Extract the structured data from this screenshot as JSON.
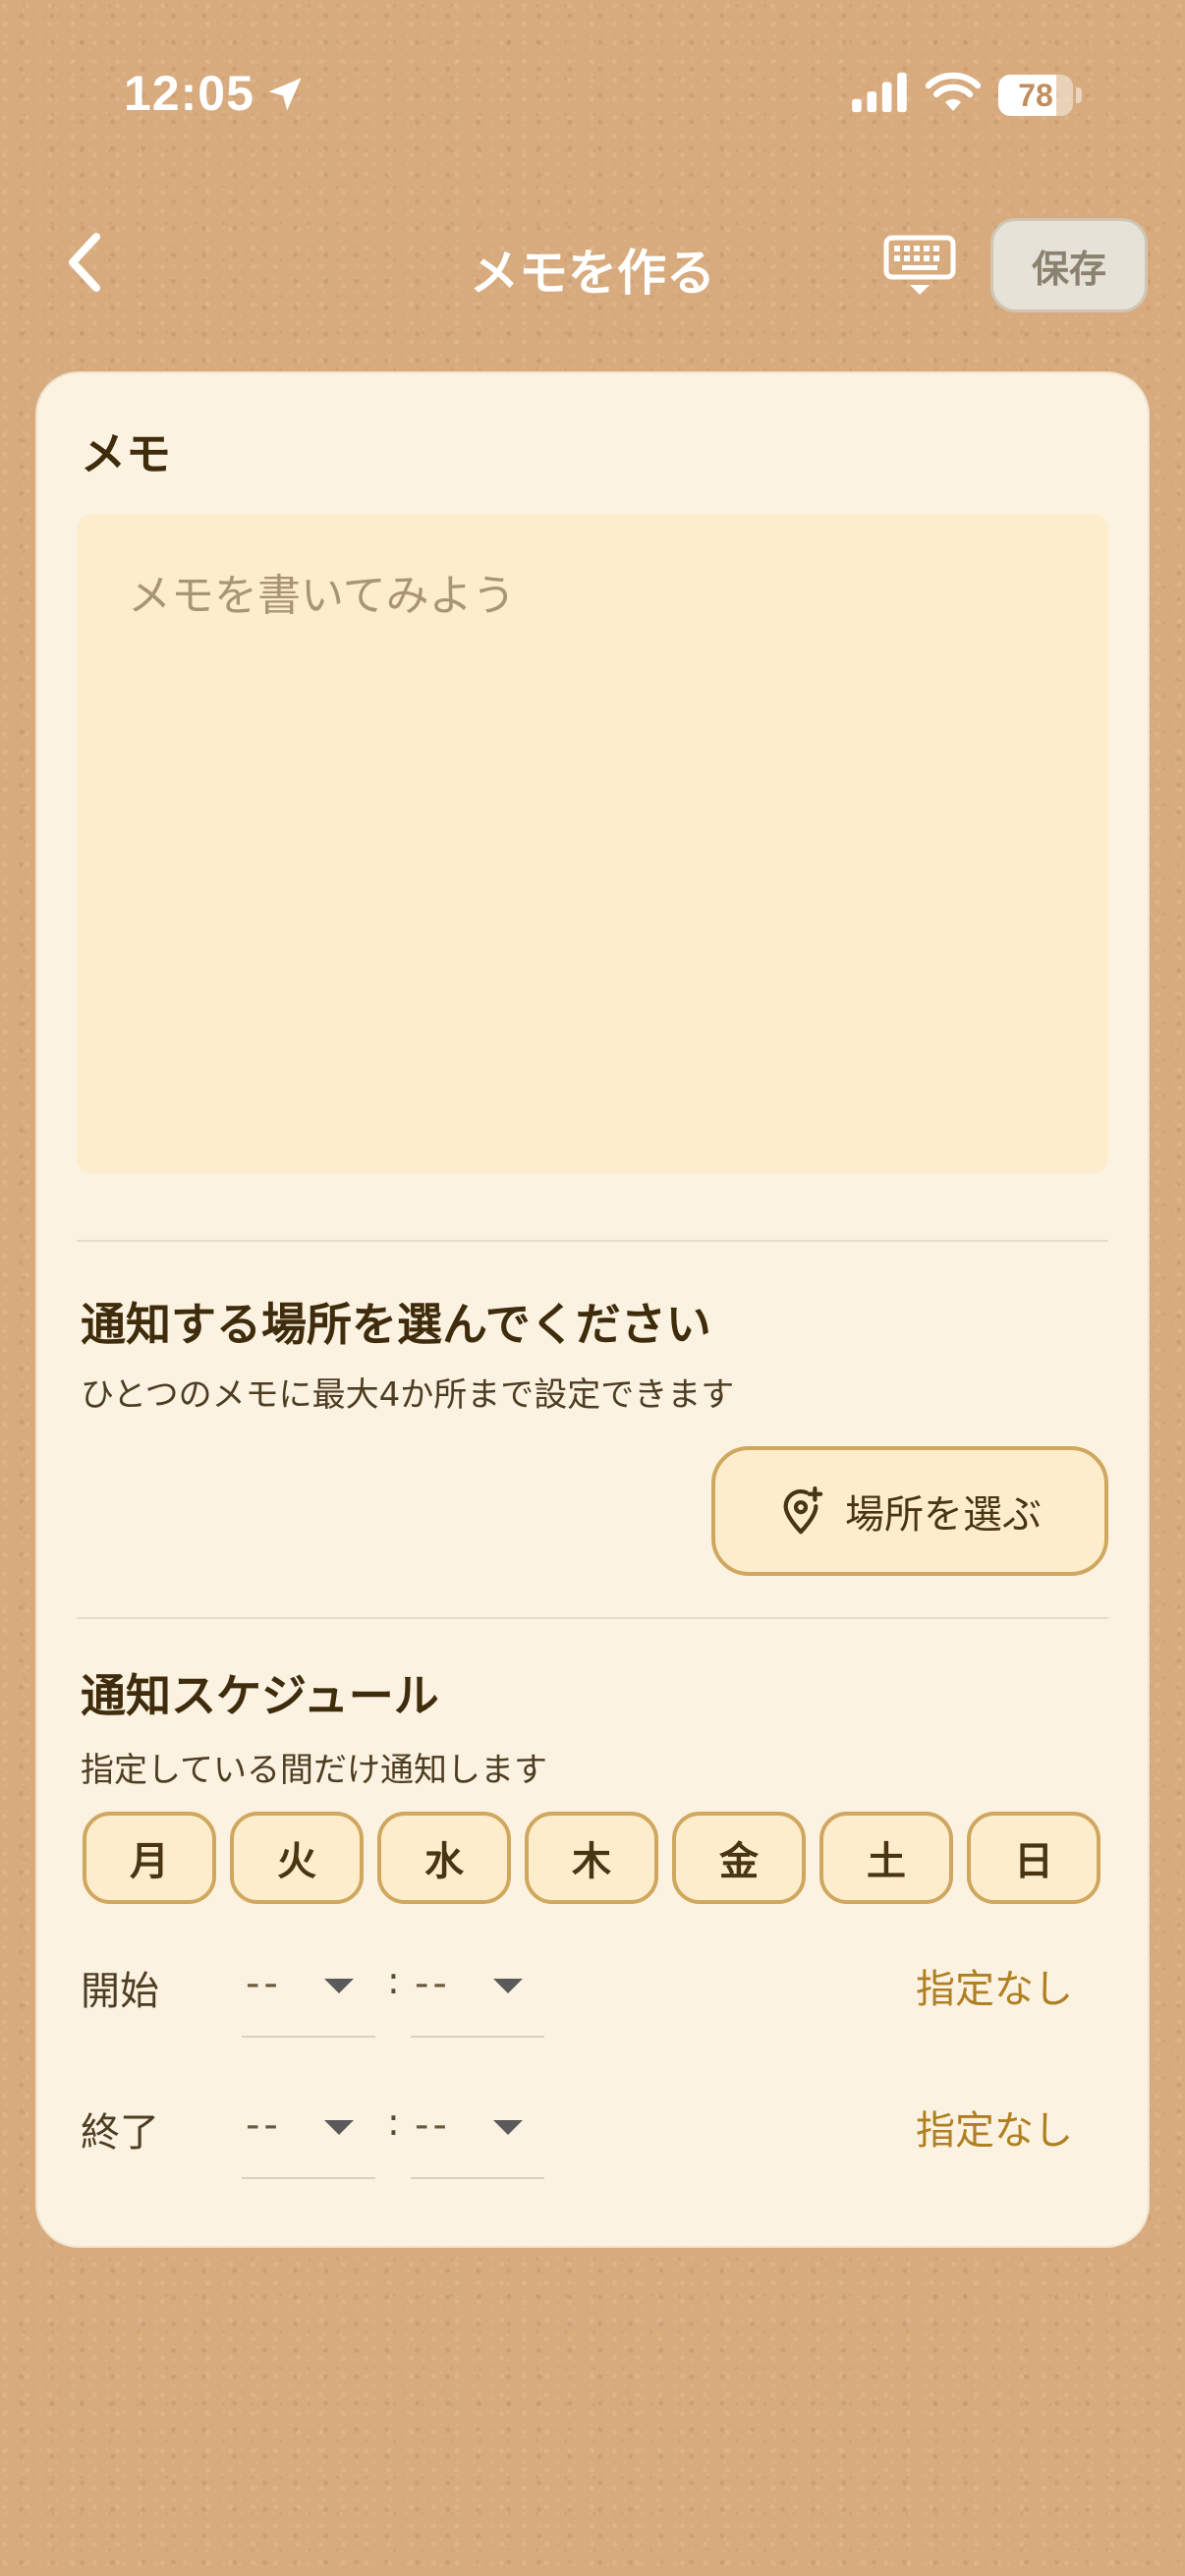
{
  "status_bar": {
    "time": "12:05",
    "battery_level": "78",
    "battery_fraction": 0.78,
    "icons": [
      "location-arrow-icon",
      "cellular-signal-icon",
      "wifi-icon",
      "battery-icon"
    ]
  },
  "nav": {
    "title": "メモを作る",
    "back_icon": "chevron-left-icon",
    "keyboard_icon": "keyboard-dismiss-icon",
    "save_label": "保存"
  },
  "memo": {
    "label": "メモ",
    "placeholder": "メモを書いてみよう",
    "value": ""
  },
  "location": {
    "title": "通知する場所を選んでください",
    "subtitle": "ひとつのメモに最大4か所まで設定できます",
    "button_label": "場所を選ぶ",
    "button_icon": "add-location-pin-icon"
  },
  "schedule": {
    "title": "通知スケジュール",
    "subtitle": "指定している間だけ通知します",
    "days": [
      "月",
      "火",
      "水",
      "木",
      "金",
      "土",
      "日"
    ],
    "start": {
      "label": "開始",
      "hour": "--",
      "minute": "--",
      "separator": ":",
      "unset_label": "指定なし"
    },
    "end": {
      "label": "終了",
      "hour": "--",
      "minute": "--",
      "separator": ":",
      "unset_label": "指定なし"
    }
  },
  "colors": {
    "background": "#d8ab7e",
    "card": "#fcf2e1",
    "input_fill": "#fdedcc",
    "accent_border": "#cfa75e",
    "accent_text": "#b07f21",
    "text_dark": "#3f2c0c"
  }
}
